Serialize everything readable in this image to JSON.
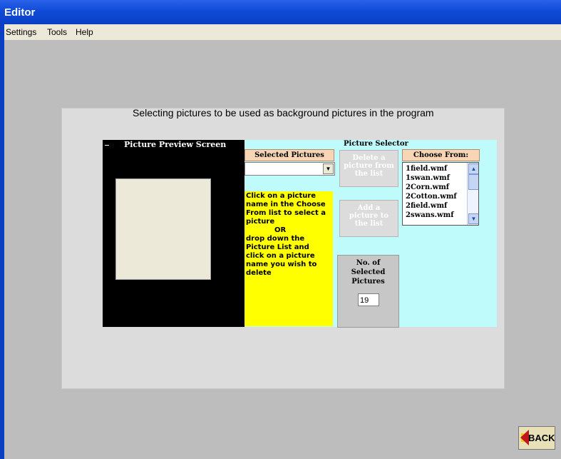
{
  "window": {
    "title": "Editor"
  },
  "menu": {
    "items": [
      "Settings",
      "Tools",
      "Help"
    ]
  },
  "heading": "Selecting pictures to be used as background pictures in the program",
  "preview": {
    "label": "Picture Preview Screen"
  },
  "selector": {
    "title": "Picture Selector",
    "selected_pictures_label": "Selected Pictures",
    "selected_value": "",
    "instructions": [
      "Click on a picture",
      "name in the Choose",
      "From list to select a",
      "picture",
      "OR",
      "drop down the",
      "Picture List and",
      "click on a picture",
      "name you wish to",
      "delete"
    ],
    "delete_button": [
      "Delete a",
      "picture from",
      "the list"
    ],
    "add_button": [
      "Add a",
      "picture to",
      "the list"
    ],
    "count_label": [
      "No. of",
      "Selected",
      "Pictures"
    ],
    "count_value": "19",
    "choose_from_label": "Choose From:",
    "choose_list": [
      "1field.wmf",
      "1swan.wmf",
      "2Corn.wmf",
      "2Cotton.wmf",
      "2field.wmf",
      "2swans.wmf"
    ]
  },
  "back_button": "BACK",
  "colors": {
    "title_bar": "#0f4bd8",
    "cyan_panel": "#c0fbfc",
    "instructions_bg": "#ffff00",
    "header_peach": "#f7d5b5"
  }
}
